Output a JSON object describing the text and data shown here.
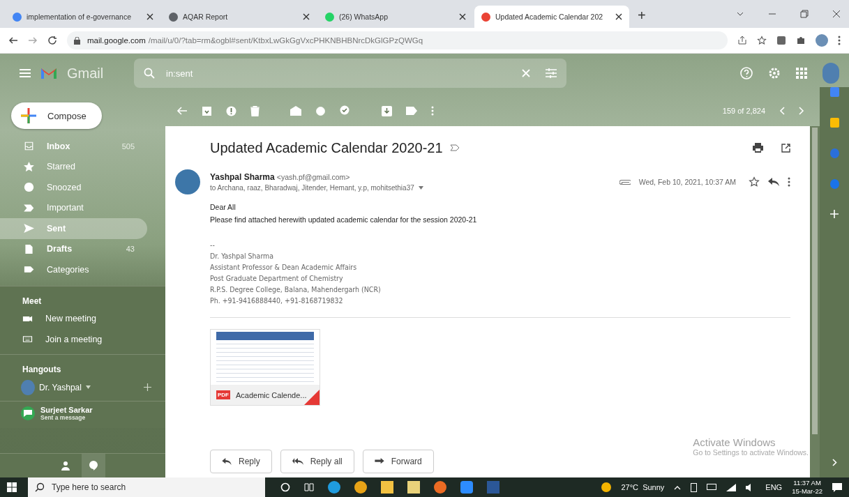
{
  "browser": {
    "tabs": [
      {
        "title": "implementation of e-governance",
        "selected": false
      },
      {
        "title": "AQAR Report",
        "selected": false
      },
      {
        "title": "(26) WhatsApp",
        "selected": false
      },
      {
        "title": "Updated Academic Calendar 202",
        "selected": true
      }
    ],
    "new_tab": "+",
    "url_host": "mail.google.com",
    "url_path": "/mail/u/0/?tab=rm&ogbl#sent/KtbxLwGkGgVxcPHKNBHBNrcDkGlGPzQWGq"
  },
  "gmail": {
    "product": "Gmail",
    "search": {
      "value": "in:sent"
    },
    "compose": "Compose",
    "nav": [
      {
        "label": "Inbox",
        "count": "505",
        "selected": false,
        "bold": true
      },
      {
        "label": "Starred",
        "selected": false,
        "bold": false
      },
      {
        "label": "Snoozed",
        "selected": false,
        "bold": false
      },
      {
        "label": "Important",
        "selected": false,
        "bold": false
      },
      {
        "label": "Sent",
        "selected": true,
        "bold": true
      },
      {
        "label": "Drafts",
        "count": "43",
        "selected": false,
        "bold": true
      },
      {
        "label": "Categories",
        "selected": false,
        "bold": false
      }
    ],
    "meet": {
      "heading": "Meet",
      "items": [
        {
          "label": "New meeting"
        },
        {
          "label": "Join a meeting"
        }
      ]
    },
    "hangouts": {
      "heading": "Hangouts",
      "user": "Dr. Yashpal",
      "contacts": [
        {
          "name": "Surjeet Sarkar",
          "status": "Sent a message"
        }
      ]
    },
    "pager": "159 of 2,824",
    "email": {
      "subject": "Updated Academic Calendar 2020-21",
      "sender_name": "Yashpal Sharma",
      "sender_email": "<yash.pf@gmail.com>",
      "recipients": "to Archana, raaz, Bharadwaj, Jitender, Hemant, y.p, mohitsethia37",
      "date": "Wed, Feb 10, 2021, 10:37 AM",
      "body": [
        "Dear All",
        "Please find attached herewith updated academic calendar for the session 2020-21"
      ],
      "signature": [
        "--",
        "Dr. Yashpal Sharma",
        "Assistant Professor & Dean Academic Affairs",
        "Post Graduate Department of Chemistry",
        "R.P.S. Degree College, Balana, Mahendergarh (NCR)",
        "Ph. +91-9416888440, +91-8168719832"
      ],
      "attachment": {
        "name": "Academic Calende...",
        "badge": "PDF"
      },
      "actions": [
        "Reply",
        "Reply all",
        "Forward"
      ]
    },
    "activation": {
      "title": "Activate Windows",
      "subtitle": "Go to Settings to activate Windows."
    }
  },
  "taskbar": {
    "search_placeholder": "Type here to search",
    "weather": "27°C  Sunny",
    "language": "ENG",
    "time": "11:37 AM",
    "date": "15-Mar-22"
  }
}
